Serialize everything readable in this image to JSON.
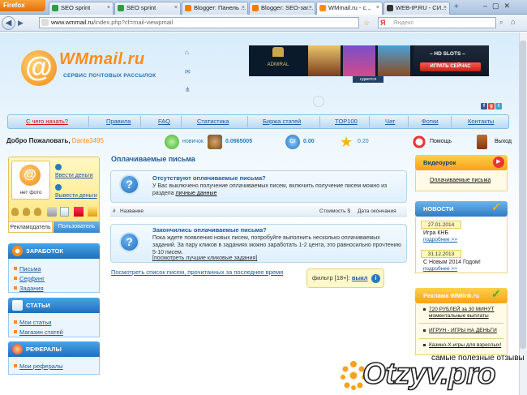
{
  "browser": {
    "firefox_label": "Firefox",
    "tabs": [
      {
        "label": "SEO sprint",
        "color": "#2e9e3f"
      },
      {
        "label": "SEO sprint",
        "color": "#2e9e3f"
      },
      {
        "label": "Blogger: Панель ...",
        "color": "#f57c00"
      },
      {
        "label": "Blogger: SEO-зar...",
        "color": "#f57c00"
      },
      {
        "label": "WMmail.ru - с...",
        "color": "#ff8c1a"
      },
      {
        "label": "WEB-IP.RU - СИ...",
        "color": "#333333"
      }
    ],
    "url_host": "www.wmmail.ru",
    "url_path": "/index.php?cf=mail-viewpmail",
    "search_placeholder": "Яндекс"
  },
  "header": {
    "logo_text": "WMmail.ru",
    "logo_subtitle": "СЕРВИС ПОЧТОВЫХ РАССЫЛОК",
    "banner": {
      "brand": "ADMIRAL",
      "hd_slots": "– HD SLOTS –",
      "play_now": "ИГРАТЬ СЕЙЧАС",
      "rent": "сдается"
    }
  },
  "menu": {
    "items": [
      "С чего начать?",
      "Правила",
      "FAQ",
      "Статистика",
      "Биржа статей",
      "TOP100",
      "Чат",
      "Фотки",
      "Контакты"
    ]
  },
  "welcome": {
    "greeting": "Добро Пожаловать,",
    "username": "Dante3495",
    "level": "новичок",
    "balance": "0.0965005",
    "credits": "0.00",
    "rating": "0.20",
    "help": "Помощь",
    "exit": "Выход"
  },
  "user": {
    "no_photo": "нет фото",
    "deposit": "Ввести деньги",
    "withdraw": "Вывести деньги",
    "tab_advertiser": "Рекламодатель",
    "tab_user": "Пользователь"
  },
  "sidebar": {
    "earn_title": "ЗАРАБОТОК",
    "earn_items": [
      "Письма",
      "Серфинг",
      "Задания"
    ],
    "articles_title": "СТАТЬИ",
    "articles_items": [
      "Мои статьи",
      "Магазин статей"
    ],
    "referrals_title": "РЕФЕРАЛЫ",
    "referrals_items": [
      "Мои рефералы"
    ]
  },
  "main": {
    "title": "Оплачиваемые письма",
    "notice1": {
      "title": "Отсутствуют оплачиваемые письма?",
      "text": "У Вас выключено получение оплачиваемых писем, включить получение писем можно из раздела",
      "link": "личные данные"
    },
    "table": {
      "col_num": "#",
      "col_name": "Название",
      "col_cost": "Стоимость $",
      "col_date": "Дата окончания"
    },
    "notice2": {
      "title": "Закончились оплачиваемые письма?",
      "text": "Пока ждете появления новых писем, попробуйте выполнить несколько оплачиваемых заданий. За пару кликов в заданиях можно заработать 1-2 цента, это равносильно прочтению 5-10 писем.",
      "link": "[посмотреть лучшие кликовые задания]"
    },
    "view_link": "Посмотреть список писем, прочитанных за последнее время",
    "filter_label": "фильтр [18+]:",
    "filter_value": "выкл"
  },
  "right": {
    "video_title": "Видеоурок",
    "video_link": "Оплачиваемые письма",
    "news_title": "НОВОСТИ",
    "news": [
      {
        "date": "27.01.2014",
        "title": "Игра КНБ",
        "more": "подробнее >>"
      },
      {
        "date": "31.12.2013",
        "title": "С Новым 2014 Годом!",
        "more": "подробнее >>"
      }
    ],
    "ads_title": "Реклама WMlink.ru",
    "ads": [
      "720 РУБЛЕЙ за 30 МИНУТ моментальные выплаты",
      "ИГРУН - ИГРЫ НА ДЕНЬГИ",
      "Казино-Х-игры для взрослых!"
    ]
  },
  "watermark": {
    "tagline": "самые полезные отзывы",
    "logo": "Otzyv.pro"
  }
}
